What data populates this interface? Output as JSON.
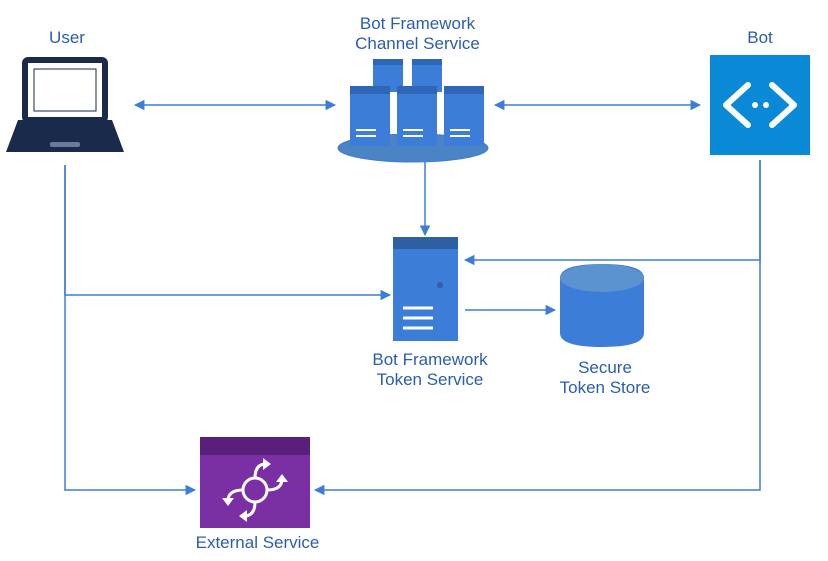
{
  "nodes": {
    "user": {
      "label": "User"
    },
    "channel_service": {
      "label": "Bot Framework\nChannel Service"
    },
    "bot": {
      "label": "Bot"
    },
    "token_service": {
      "label": "Bot Framework\nToken Service"
    },
    "token_store": {
      "label": "Secure\nToken Store"
    },
    "external_service": {
      "label": "External Service"
    }
  },
  "colors": {
    "blue": "#3c7dd9",
    "blue_dark": "#1f4ea1",
    "navy": "#1a2a4a",
    "purple": "#7b2fa5",
    "cyl_fill": "#4a84c4"
  }
}
